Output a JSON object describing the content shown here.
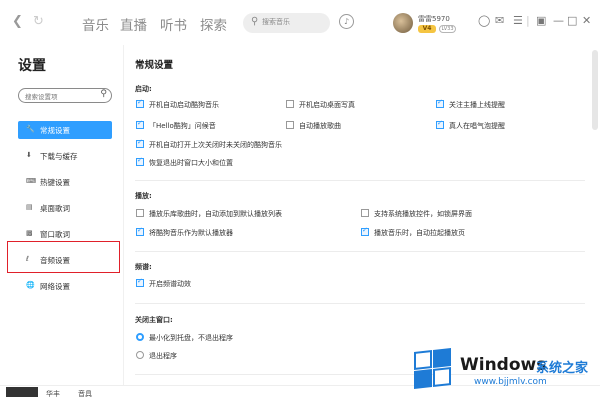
{
  "titlebar": {
    "tabs": [
      "音乐",
      "直播",
      "听书",
      "探索"
    ],
    "search_placeholder": "搜索音乐",
    "username": "雷雷5970",
    "vip_label": "V4",
    "level_label": "LV33"
  },
  "sidebar": {
    "title": "设置",
    "search_placeholder": "搜索设置项",
    "items": [
      {
        "label": "常规设置",
        "icon": "wrench-icon"
      },
      {
        "label": "下载与缓存",
        "icon": "download-icon"
      },
      {
        "label": "热键设置",
        "icon": "keyboard-icon"
      },
      {
        "label": "桌面歌词",
        "icon": "desktop-lyrics-icon"
      },
      {
        "label": "窗口歌词",
        "icon": "window-lyrics-icon"
      },
      {
        "label": "音频设置",
        "icon": "audio-wave-icon"
      },
      {
        "label": "网络设置",
        "icon": "network-icon"
      }
    ]
  },
  "main": {
    "title": "常规设置",
    "startup": {
      "heading": "启动:",
      "options": [
        "开机自动启动酷狗音乐",
        "开机启动桌面写真",
        "关注主播上线提醒",
        "「Hello酷狗」问候音",
        "自动播放歌曲",
        "真人在唱气泡提醒",
        "开机自动打开上次关闭时未关闭的酷狗音乐",
        "恢复退出时窗口大小和位置"
      ]
    },
    "playback": {
      "heading": "播放:",
      "options": [
        "播放乐库歌曲时，自动添加到默认播放列表",
        "支持系统播放控件，如锁屏界面",
        "将酷狗音乐作为默认播放器",
        "播放音乐时，自动拉起播放页"
      ]
    },
    "spectrum": {
      "heading": "频谱:",
      "options": [
        "开启频谱动效"
      ]
    },
    "close": {
      "heading": "关闭主窗口:",
      "options": [
        "最小化到托盘，不退出程序",
        "退出程序"
      ]
    }
  },
  "bottom": {
    "text1": "华丰",
    "text2": "音具 "
  },
  "watermark": {
    "title": "Windows",
    "cn": "系统之家",
    "url": "www.bjjmlv.com"
  }
}
